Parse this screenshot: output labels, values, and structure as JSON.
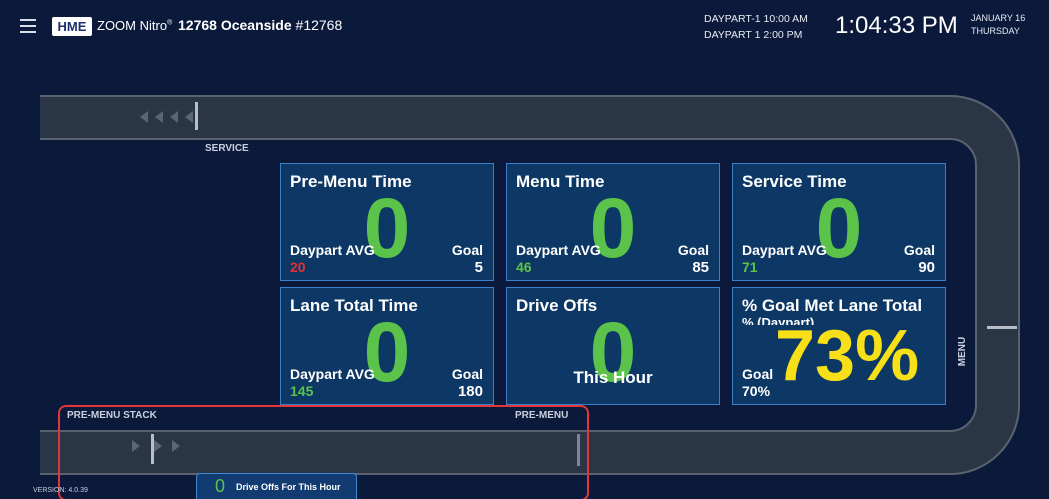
{
  "header": {
    "brand": "HME",
    "product": "ZOOM Nitro",
    "product_mark": "®",
    "store_number": "12768 Oceanside",
    "store_id": "#12768",
    "daypart_line1": "DAYPART-1  10:00 AM",
    "daypart_line2": "DAYPART 1  2:00 PM",
    "clock": "1:04:33 PM",
    "date_line1": "JANUARY 16",
    "date_line2": "THURSDAY"
  },
  "track": {
    "service_label": "SERVICE",
    "premenu_stack_label": "PRE-MENU STACK",
    "premenu_label": "PRE-MENU",
    "menu_label": "MENU"
  },
  "tiles": [
    {
      "title": "Pre-Menu Time",
      "value": "0",
      "avg_label": "Daypart AVG",
      "avg_value": "20",
      "goal_label": "Goal",
      "goal_value": "5",
      "avg_color": "red"
    },
    {
      "title": "Menu Time",
      "value": "0",
      "avg_label": "Daypart AVG",
      "avg_value": "46",
      "goal_label": "Goal",
      "goal_value": "85",
      "avg_color": "green"
    },
    {
      "title": "Service Time",
      "value": "0",
      "avg_label": "Daypart AVG",
      "avg_value": "71",
      "goal_label": "Goal",
      "goal_value": "90",
      "avg_color": "green"
    },
    {
      "title": "Lane Total Time",
      "value": "0",
      "avg_label": "Daypart AVG",
      "avg_value": "145",
      "goal_label": "Goal",
      "goal_value": "180",
      "avg_color": "green"
    },
    {
      "title": "Drive Offs",
      "value": "0",
      "sub_label": "This Hour"
    },
    {
      "title": "% Goal Met Lane Total",
      "subtitle": "% (Daypart)",
      "value": "73%",
      "goal_label": "Goal",
      "goal_value": "70%"
    }
  ],
  "drive_offs_box": {
    "value": "0",
    "label": "Drive Offs For This Hour"
  },
  "version": "VERSION: 4.0.39",
  "colors": {
    "background": "#0b1a3b",
    "tile_bg": "#0d3764",
    "tile_border": "#3a80c8",
    "good": "#5cc34a",
    "bad": "#e5302d",
    "highlight": "#f7e017",
    "selection_box": "#e3363a"
  }
}
